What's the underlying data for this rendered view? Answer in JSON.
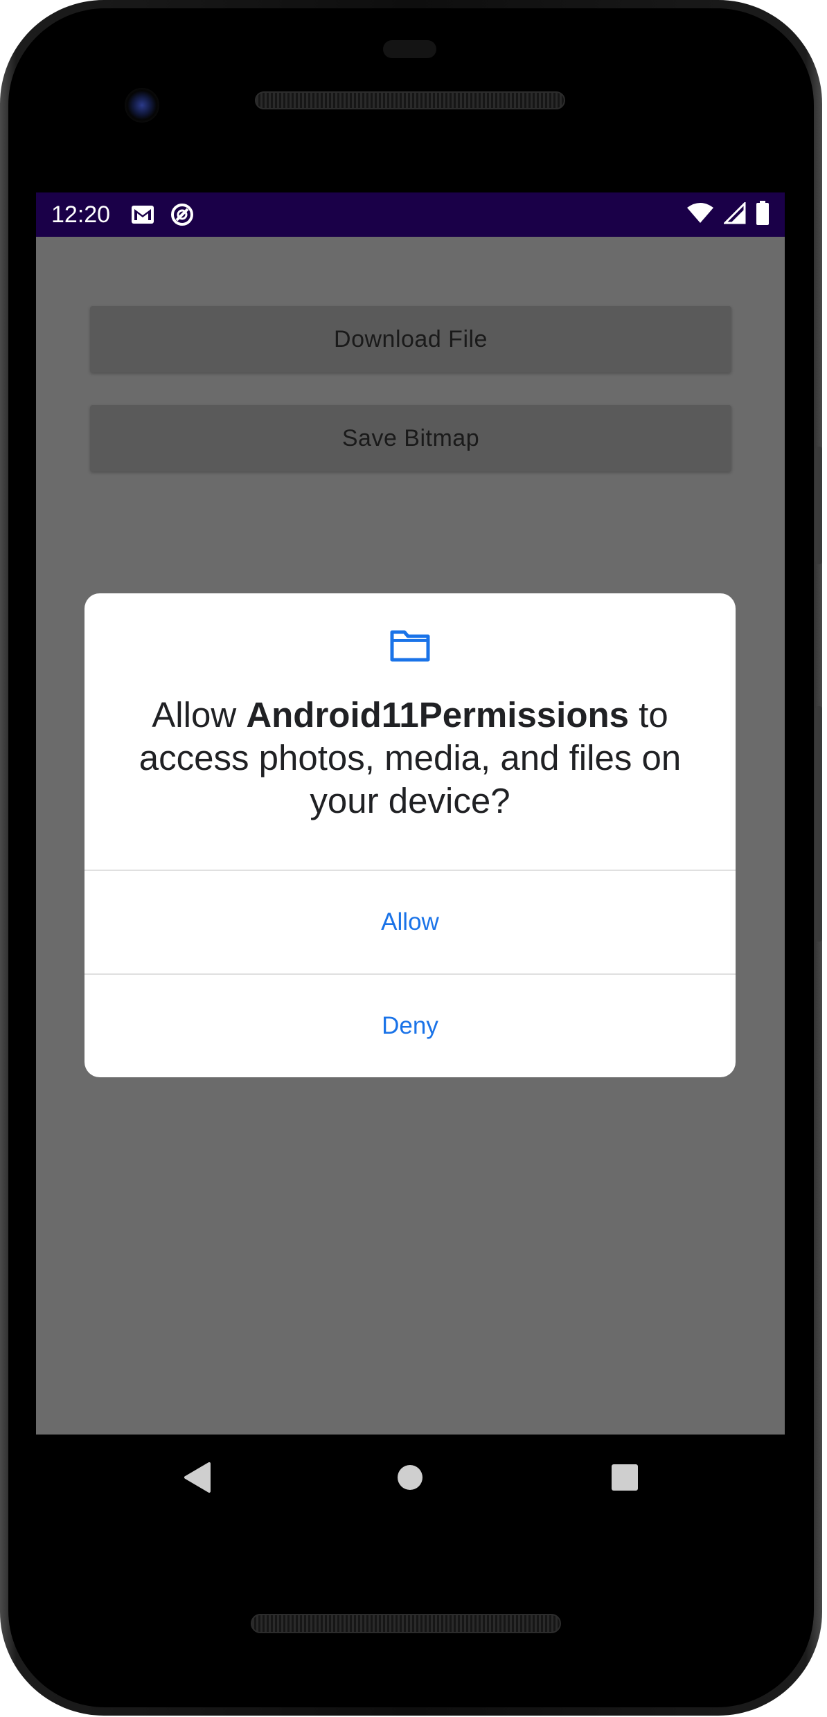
{
  "status_bar": {
    "time": "12:20",
    "left_icons": [
      "gmail-icon",
      "do-not-disturb-icon"
    ],
    "right_icons": [
      "wifi-icon",
      "cellular-signal-icon",
      "battery-icon"
    ],
    "background": "#1a0048"
  },
  "app": {
    "buttons": [
      {
        "label": "Download File"
      },
      {
        "label": "Save Bitmap"
      }
    ]
  },
  "permission_dialog": {
    "icon": "folder-icon",
    "message_prefix": "Allow ",
    "app_name": "Android11Permissions",
    "message_suffix": " to access photos, media, and files on your device?",
    "actions": {
      "allow": "Allow",
      "deny": "Deny"
    },
    "accent_color": "#1a73e8"
  },
  "navigation_bar": {
    "items": [
      "back-icon",
      "home-icon",
      "recents-icon"
    ]
  }
}
